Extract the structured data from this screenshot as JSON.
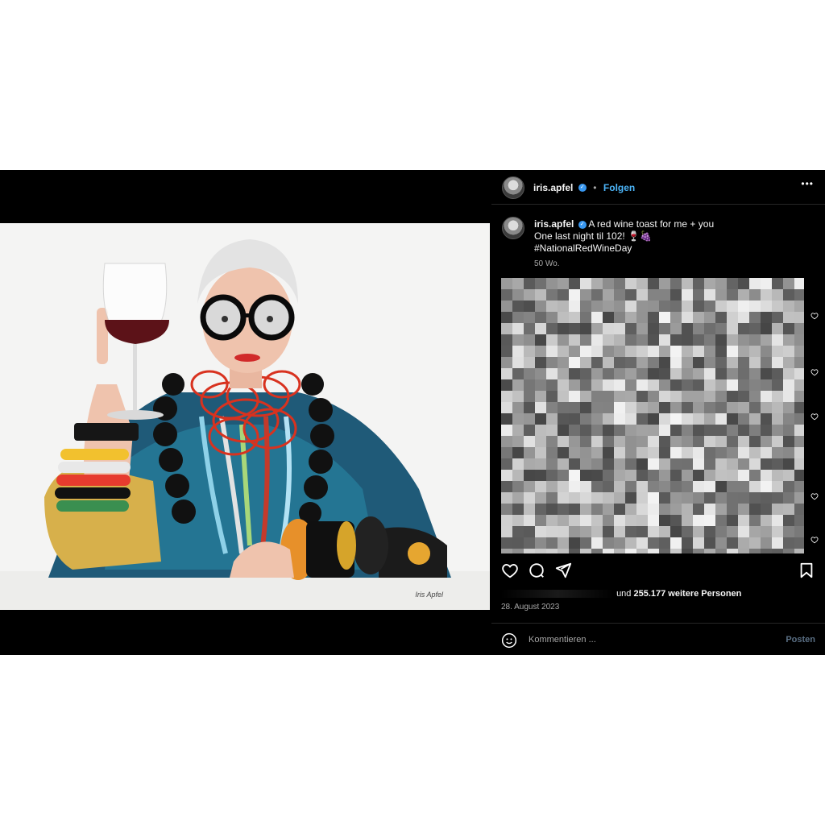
{
  "post": {
    "username": "iris.apfel",
    "follow_label": "Folgen",
    "more_label": "•••",
    "caption": {
      "line1": "A red wine toast for me + you",
      "line2": "One last night til 102! 🍷🍇",
      "line3": "#NationalRedWineDay"
    },
    "time_ago": "50 Wo.",
    "photo_credit": "Iris Apfel",
    "likes_suffix": "und",
    "likes_count": "255.177 weitere Personen",
    "date": "28. August 2023",
    "comment_placeholder": "Kommentieren ...",
    "post_label": "Posten"
  },
  "icons": {
    "more": "more-options-icon",
    "verified": "verified-badge-icon",
    "like": "heart-icon",
    "comment": "comment-icon",
    "share": "share-icon",
    "save": "bookmark-icon",
    "emoji": "emoji-icon"
  },
  "colors": {
    "accent": "#4cb5f9",
    "verified": "#3897f0",
    "background": "#000000"
  }
}
